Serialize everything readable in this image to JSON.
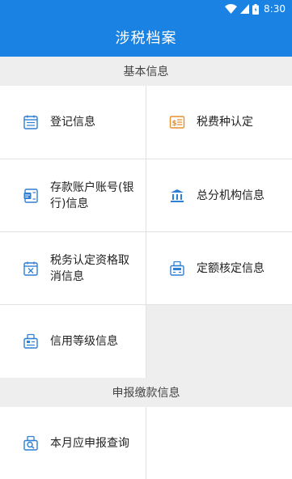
{
  "status_bar": {
    "time": "8:30"
  },
  "app_bar": {
    "title": "涉税档案"
  },
  "sections": [
    {
      "title": "基本信息",
      "items": [
        {
          "label": "登记信息",
          "icon": "calendar-icon"
        },
        {
          "label": "税费种认定",
          "icon": "money-list-icon"
        },
        {
          "label": "存款账户账号(银行)信息",
          "icon": "bank-card-icon"
        },
        {
          "label": "总分机构信息",
          "icon": "institution-icon"
        },
        {
          "label": "税务认定资格取消信息",
          "icon": "calendar-cancel-icon"
        },
        {
          "label": "定额核定信息",
          "icon": "register-icon"
        },
        {
          "label": "信用等级信息",
          "icon": "credit-icon"
        }
      ]
    },
    {
      "title": "申报缴款信息",
      "items": [
        {
          "label": "本月应申报查询",
          "icon": "search-document-icon"
        }
      ]
    }
  ],
  "colors": {
    "primary": "#1a82e2",
    "icon_blue": "#2f7fd3",
    "icon_orange": "#e8912c"
  }
}
